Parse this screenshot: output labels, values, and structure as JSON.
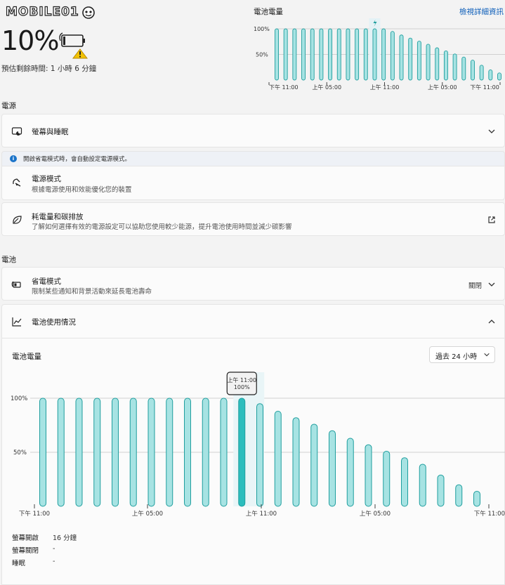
{
  "logo": {
    "text": "MOBILE01"
  },
  "battery": {
    "percent": "10%",
    "remaining": "預估剩餘時間: 1 小時 6 分鐘",
    "level": 0.1
  },
  "mini_chart": {
    "title": "電池電量",
    "link": "檢視詳細資訊",
    "chart_data": {
      "type": "bar",
      "y_ticks": [
        "100%",
        "50%"
      ],
      "x_ticks": [
        "下午 11:00",
        "上午 05:00",
        "上午 11:00",
        "上午 05:00",
        "下午 11:00"
      ],
      "values": [
        100,
        100,
        100,
        100,
        100,
        100,
        100,
        100,
        100,
        100,
        100,
        100,
        100,
        95,
        88,
        82,
        76,
        70,
        63,
        57,
        51,
        45,
        39,
        29,
        20,
        14
      ],
      "ylim": [
        0,
        100
      ],
      "charging_marker_index": 11
    }
  },
  "power_section": {
    "title": "電源",
    "screen_sleep": {
      "title": "螢幕與睡眠"
    },
    "info_text": "開啟省電模式時，會自動設定電源模式。",
    "power_mode": {
      "title": "電源模式",
      "subtitle": "根據電源使用和效能優化您的裝置"
    },
    "energy": {
      "title": "耗電量和碳排放",
      "subtitle": "了解如何選擇有效的電源設定可以協助您使用較少能源，提升電池使用時間並減少碳影響"
    }
  },
  "battery_section": {
    "title": "電池",
    "saver": {
      "title": "省電模式",
      "subtitle": "限制某些通知和背景活動來延長電池壽命",
      "status": "關閉"
    },
    "usage": {
      "title": "電池使用情況"
    }
  },
  "usage_panel": {
    "chart_title": "電池電量",
    "dropdown_value": "過去 24 小時",
    "chart_data": {
      "type": "bar",
      "title": "電池電量",
      "y_ticks": [
        "100%",
        "50%"
      ],
      "x_ticks": [
        "下午 11:00",
        "上午 05:00",
        "上午 11:00",
        "上午 05:00",
        "下午 11:00"
      ],
      "values": [
        100,
        100,
        100,
        100,
        100,
        100,
        100,
        100,
        100,
        100,
        100,
        100,
        95,
        88,
        82,
        76,
        70,
        63,
        57,
        51,
        45,
        39,
        29,
        20,
        14
      ],
      "ylim": [
        0,
        100
      ],
      "highlight_index": 11,
      "tooltip": {
        "time": "上午 11:00",
        "value": "100%"
      }
    },
    "stats": [
      {
        "label": "螢幕開啟",
        "value": "16 分鐘"
      },
      {
        "label": "螢幕關閉",
        "value": "-"
      },
      {
        "label": "睡眠",
        "value": "-"
      }
    ]
  },
  "colors": {
    "bar_fill": "#a7e3e3",
    "bar_stroke": "#1f9e9e",
    "bar_highlight": "#2cbdbd",
    "accent_link": "#0a5cb8"
  }
}
